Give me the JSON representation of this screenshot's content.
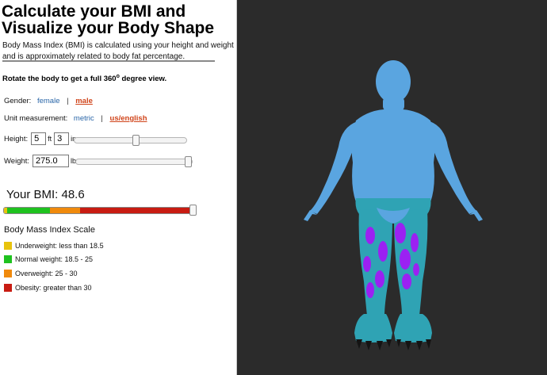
{
  "page": {
    "title": "Calculate your BMI and Visualize your Body Shape",
    "intro": "Body Mass Index (BMI) is calculated using your height and weight and is approximately related to body fat percentage.",
    "rotate_hint_prefix": "Rotate the body to get a full 360",
    "rotate_hint_sup": "o",
    "rotate_hint_suffix": " degree view."
  },
  "gender": {
    "label": "Gender:",
    "options": [
      "female",
      "male"
    ],
    "separator": "|",
    "selected": "male"
  },
  "units": {
    "label": "Unit measurement:",
    "options": [
      "metric",
      "us/english"
    ],
    "separator": "|",
    "selected": "us/english"
  },
  "height": {
    "label": "Height:",
    "feet": "5",
    "feet_unit": "ft",
    "inches": "3",
    "inches_unit": "in",
    "slider_fraction": 0.55
  },
  "weight": {
    "label": "Weight:",
    "value": "275.0",
    "unit": "lb",
    "slider_fraction": 1.0
  },
  "bmi": {
    "label": "Your BMI:",
    "value": "48.6"
  },
  "scale": {
    "title": "Body Mass Index Scale",
    "items": [
      {
        "label": "Underweight: less than 18.5",
        "color": "#e8c30d"
      },
      {
        "label": "Normal weight: 18.5 - 25",
        "color": "#1fc21f"
      },
      {
        "label": "Overweight: 25 - 30",
        "color": "#f08a0c"
      },
      {
        "label": "Obesity: greater than 30",
        "color": "#c81c12"
      }
    ]
  },
  "viewer": {
    "background": "#2b2b2b",
    "skin_color": "#5aa5e0",
    "shorts_color": "#2fa3b4",
    "spots_color": "#9b21f2",
    "claw_color": "#141414"
  }
}
